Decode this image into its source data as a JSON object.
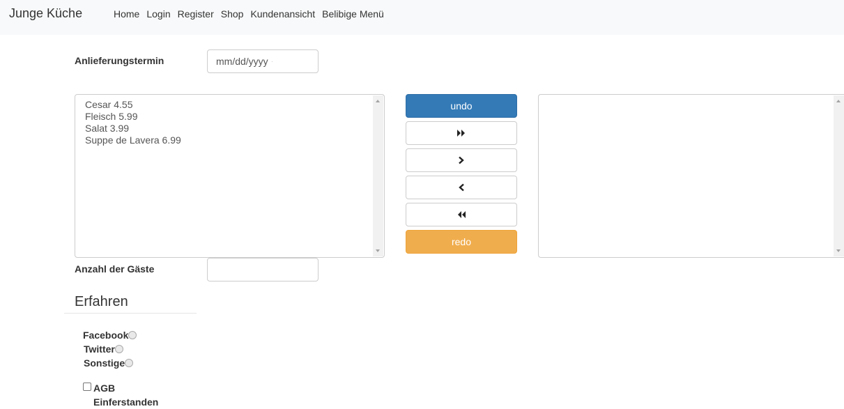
{
  "navbar": {
    "brand": "Junge Küche",
    "links": [
      "Home",
      "Login",
      "Register",
      "Shop",
      "Kundenansicht",
      "Belibige Menü"
    ]
  },
  "form": {
    "delivery_label": "Anlieferungstermin",
    "delivery_placeholder": "mm/dd/yyyy",
    "guests_label": "Anzahl der Gäste",
    "guests_value": ""
  },
  "menu_list": {
    "items": [
      "Cesar 4.55",
      "Fleisch 5.99",
      "Salat 3.99",
      "Suppe de Lavera 6.99"
    ]
  },
  "selected_list": {
    "items": []
  },
  "controls": {
    "undo_label": "undo",
    "redo_label": "redo",
    "move_all_right_icon": "double-chevron-right-icon",
    "move_right_icon": "chevron-right-icon",
    "move_left_icon": "chevron-left-icon",
    "move_all_left_icon": "double-chevron-left-icon"
  },
  "experience": {
    "heading": "Erfahren",
    "options": [
      "Facebook",
      "Twitter",
      "Sonstige"
    ]
  },
  "agb": {
    "label": "AGB Einferstanden"
  },
  "colors": {
    "navbar_bg": "#f8f9fa",
    "undo_bg": "#337ab7",
    "redo_bg": "#f0ad4e"
  }
}
